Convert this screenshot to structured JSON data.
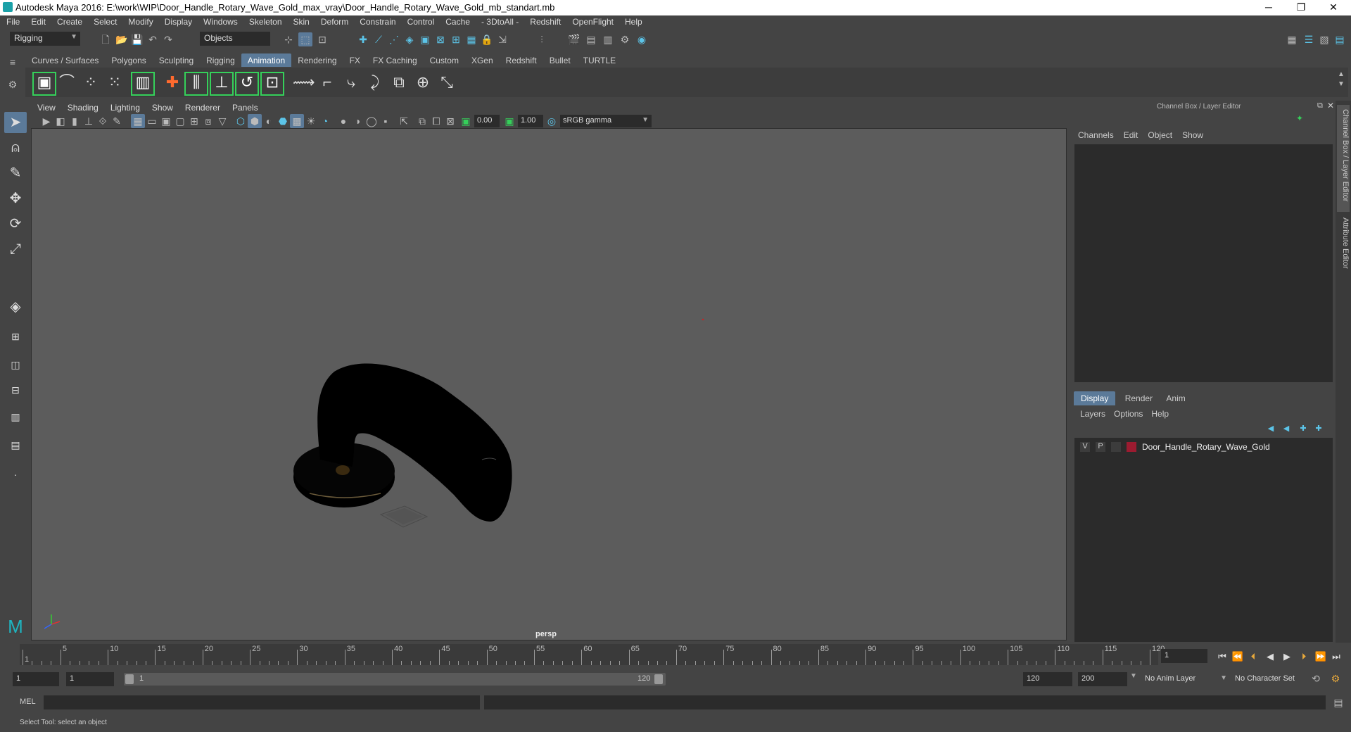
{
  "titlebar": {
    "title": "Autodesk Maya 2016: E:\\work\\WIP\\Door_Handle_Rotary_Wave_Gold_max_vray\\Door_Handle_Rotary_Wave_Gold_mb_standart.mb",
    "minimize": "─",
    "restore": "❐",
    "close": "✕"
  },
  "menubar": [
    "File",
    "Edit",
    "Create",
    "Select",
    "Modify",
    "Display",
    "Windows",
    "Skeleton",
    "Skin",
    "Deform",
    "Constrain",
    "Control",
    "Cache",
    "- 3DtoAll -",
    "Redshift",
    "OpenFlight",
    "Help"
  ],
  "statusline": {
    "menuset": "Rigging",
    "selection_mode": "Objects"
  },
  "shelf": {
    "tabs": [
      "Curves / Surfaces",
      "Polygons",
      "Sculpting",
      "Rigging",
      "Animation",
      "Rendering",
      "FX",
      "FX Caching",
      "Custom",
      "XGen",
      "Redshift",
      "Bullet",
      "TURTLE"
    ],
    "active_tab": "Animation"
  },
  "viewport": {
    "menus": [
      "View",
      "Shading",
      "Lighting",
      "Show",
      "Renderer",
      "Panels"
    ],
    "exposure": "0.00",
    "gamma": "1.00",
    "color_space": "sRGB gamma",
    "camera_label": "persp"
  },
  "channelbox": {
    "header": "Channel Box / Layer Editor",
    "menus": [
      "Channels",
      "Edit",
      "Object",
      "Show"
    ]
  },
  "layereditor": {
    "tabs": [
      "Display",
      "Render",
      "Anim"
    ],
    "active_tab": "Display",
    "menus": [
      "Layers",
      "Options",
      "Help"
    ],
    "layers": [
      {
        "v": "V",
        "p": "P",
        "name": "Door_Handle_Rotary_Wave_Gold",
        "color": "#9b1b30"
      }
    ]
  },
  "sidetabs": {
    "channel": "Channel Box / Layer Editor",
    "attribute": "Attribute Editor"
  },
  "timeline": {
    "labels": [
      "1",
      "5",
      "10",
      "15",
      "20",
      "25",
      "30",
      "35",
      "40",
      "45",
      "50",
      "55",
      "60",
      "65",
      "70",
      "75",
      "80",
      "85",
      "90",
      "95",
      "100",
      "105",
      "110",
      "115",
      "120"
    ],
    "current_frame": "1"
  },
  "range": {
    "start": "1",
    "playback_start": "1",
    "slider_start": "1",
    "slider_end": "120",
    "playback_end": "120",
    "end": "200",
    "anim_layer": "No Anim Layer",
    "character_set": "No Character Set"
  },
  "commandline": {
    "label": "MEL"
  },
  "helpline": {
    "text": "Select Tool: select an object"
  }
}
